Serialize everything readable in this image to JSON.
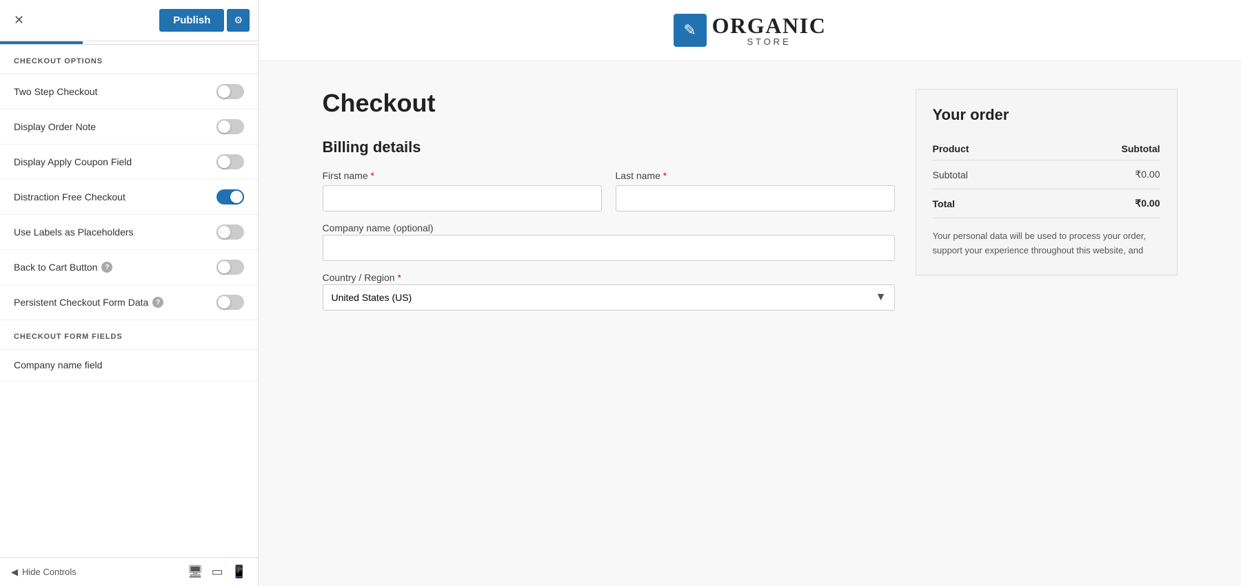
{
  "sidebar": {
    "close_label": "✕",
    "publish_label": "Publish",
    "settings_icon": "⚙",
    "checkout_options_title": "CHECKOUT OPTIONS",
    "options": [
      {
        "id": "two-step",
        "label": "Two Step Checkout",
        "active": false,
        "has_help": false
      },
      {
        "id": "display-order-note",
        "label": "Display Order Note",
        "active": false,
        "has_help": false
      },
      {
        "id": "display-coupon",
        "label": "Display Apply Coupon Field",
        "active": false,
        "has_help": false
      },
      {
        "id": "distraction-free",
        "label": "Distraction Free Checkout",
        "active": true,
        "has_help": false
      },
      {
        "id": "use-labels",
        "label": "Use Labels as Placeholders",
        "active": false,
        "has_help": false
      },
      {
        "id": "back-to-cart",
        "label": "Back to Cart Button",
        "active": false,
        "has_help": true
      },
      {
        "id": "persistent-form",
        "label": "Persistent Checkout Form Data",
        "active": false,
        "has_help": true
      }
    ],
    "form_fields_title": "CHECKOUT FORM FIELDS",
    "company_name_field_label": "Company name field",
    "hide_controls_label": "Hide Controls"
  },
  "preview": {
    "logo_icon": "✎",
    "logo_organic": "ORGANIC",
    "logo_store": "STORE",
    "checkout_title": "Checkout",
    "billing_title": "Billing details",
    "first_name_label": "First name",
    "last_name_label": "Last name",
    "company_name_label": "Company name (optional)",
    "country_label": "Country / Region",
    "country_value": "United States (US)",
    "required_star": "*"
  },
  "order": {
    "title": "Your order",
    "product_col": "Product",
    "subtotal_col": "Subtotal",
    "subtotal_label": "Subtotal",
    "subtotal_value": "₹0.00",
    "total_label": "Total",
    "total_value": "₹0.00",
    "note": "Your personal data will be used to process your order, support your experience throughout this website, and"
  }
}
